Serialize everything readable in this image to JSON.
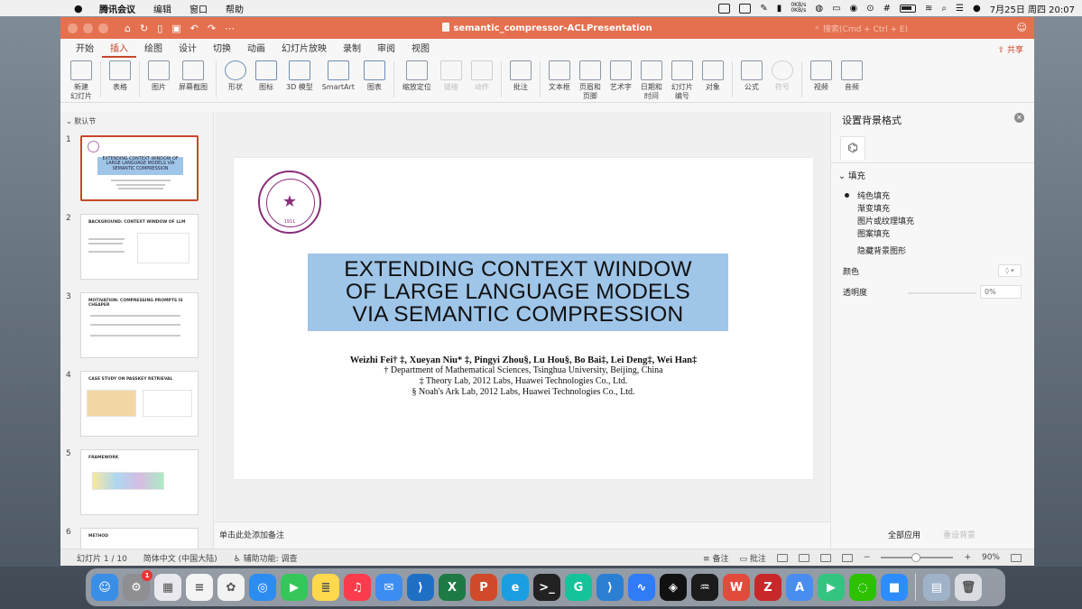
{
  "menubar": {
    "app_name": "腾讯会议",
    "items": [
      "编辑",
      "窗口",
      "帮助"
    ],
    "net_up": "0KB/s",
    "net_down": "0KB/s",
    "datetime": "7月25日 周四  20:07"
  },
  "window": {
    "title": "semantic_compressor-ACLPresentation",
    "search_placeholder": "搜索(Cmd + Ctrl + E)",
    "accent_color": "#e5704f"
  },
  "menu_tabs": [
    "开始",
    "插入",
    "绘图",
    "设计",
    "切换",
    "动画",
    "幻灯片放映",
    "录制",
    "审阅",
    "视图"
  ],
  "active_tab": "插入",
  "share_label": "共享",
  "ribbon": [
    {
      "label": "新建\n幻灯片",
      "icon": "new-slide-icon",
      "disabled": false
    },
    {
      "label": "表格",
      "icon": "table-icon",
      "disabled": false
    },
    {
      "label": "图片",
      "icon": "picture-icon",
      "disabled": false
    },
    {
      "label": "屏幕截图",
      "icon": "screenshot-icon",
      "disabled": false
    },
    {
      "label": "形状",
      "icon": "shape-icon",
      "disabled": false
    },
    {
      "label": "图标",
      "icon": "icons-icon",
      "disabled": false
    },
    {
      "label": "3D 模型",
      "icon": "3d-model-icon",
      "disabled": false
    },
    {
      "label": "SmartArt",
      "icon": "smartart-icon",
      "disabled": false
    },
    {
      "label": "图表",
      "icon": "chart-icon",
      "disabled": false
    },
    {
      "label": "缩放定位",
      "icon": "zoom-icon",
      "disabled": false
    },
    {
      "label": "链接",
      "icon": "link-icon",
      "disabled": true
    },
    {
      "label": "动作",
      "icon": "action-icon",
      "disabled": true
    },
    {
      "label": "批注",
      "icon": "comment-icon",
      "disabled": false
    },
    {
      "label": "文本框",
      "icon": "textbox-icon",
      "disabled": false
    },
    {
      "label": "页眉和\n页脚",
      "icon": "header-footer-icon",
      "disabled": false
    },
    {
      "label": "艺术字",
      "icon": "wordart-icon",
      "disabled": false
    },
    {
      "label": "日期和\n时间",
      "icon": "date-time-icon",
      "disabled": false
    },
    {
      "label": "幻灯片\n编号",
      "icon": "slide-number-icon",
      "disabled": false
    },
    {
      "label": "对象",
      "icon": "object-icon",
      "disabled": false
    },
    {
      "label": "公式",
      "icon": "equation-icon",
      "disabled": false
    },
    {
      "label": "符号",
      "icon": "symbol-icon",
      "disabled": true
    },
    {
      "label": "视频",
      "icon": "video-icon",
      "disabled": false
    },
    {
      "label": "音频",
      "icon": "audio-icon",
      "disabled": false
    }
  ],
  "slides_pane": {
    "section": "默认节",
    "slides": [
      {
        "num": "1",
        "title": "EXTENDING CONTEXT WINDOW OF LARGE LANGUAGE MODELS VIA SEMANTIC COMPRESSION"
      },
      {
        "num": "2",
        "title": "BACKGROUND: CONTEXT WINDOW OF LLM"
      },
      {
        "num": "3",
        "title": "MOTIVATION: COMPRESSING PROMPTS IS CHEAPER"
      },
      {
        "num": "4",
        "title": "CASE STUDY ON PASSKEY RETRIEVAL"
      },
      {
        "num": "5",
        "title": "FRAMEWORK"
      },
      {
        "num": "6",
        "title": "METHOD"
      }
    ]
  },
  "slide": {
    "seal_year": "1911",
    "title_lines": [
      "EXTENDING CONTEXT WINDOW",
      "OF LARGE LANGUAGE MODELS",
      "VIA SEMANTIC COMPRESSION"
    ],
    "authors": "Weizhi Fei† ‡, Xueyan Niu* ‡, Pingyi Zhou§, Lu Hou§, Bo Bai‡, Lei Deng‡, Wei Han‡",
    "affiliations": [
      "† Department of Mathematical Sciences, Tsinghua University, Beijing, China",
      "‡ Theory Lab, 2012 Labs, Huawei Technologies Co., Ltd.",
      "§ Noah's Ark Lab, 2012 Labs, Huawei Technologies Co., Ltd."
    ],
    "title_bg": "#9fc5e8"
  },
  "notes_placeholder": "单击此处添加备注",
  "format_panel": {
    "title": "设置背景格式",
    "section": "填充",
    "options": [
      "纯色填充",
      "渐变填充",
      "图片或纹理填充",
      "图案填充"
    ],
    "hide_bg": "隐藏背景图形",
    "color_label": "颜色",
    "transparency_label": "透明度",
    "transparency_value": "0%",
    "apply_all": "全部应用",
    "reset_bg": "重设背景"
  },
  "statusbar": {
    "slide_info": "幻灯片 1 / 10",
    "language": "简体中文 (中国大陆)",
    "accessibility": "辅助功能: 调查",
    "notes": "备注",
    "comments": "批注",
    "zoom": "90%"
  },
  "dock": {
    "apps": [
      {
        "name": "finder-icon",
        "color": "#3a8ee6",
        "glyph": "☺"
      },
      {
        "name": "system-settings-icon",
        "color": "#8e8e93",
        "glyph": "⚙",
        "badge": "1"
      },
      {
        "name": "launchpad-icon",
        "color": "#e8e8ee",
        "glyph": "▦"
      },
      {
        "name": "reminders-icon",
        "color": "#f4f4f4",
        "glyph": "≡"
      },
      {
        "name": "photos-icon",
        "color": "#f2f2f2",
        "glyph": "✿"
      },
      {
        "name": "safari-icon",
        "color": "#2d8cf0",
        "glyph": "◎"
      },
      {
        "name": "facetime-icon",
        "color": "#35c759",
        "glyph": "▶"
      },
      {
        "name": "notes-icon",
        "color": "#ffd84d",
        "glyph": "≣"
      },
      {
        "name": "music-icon",
        "color": "#fa3c4c",
        "glyph": "♫"
      },
      {
        "name": "mail-icon",
        "color": "#3b8df2",
        "glyph": "✉"
      },
      {
        "name": "vscode-icon",
        "color": "#1f6fc5",
        "glyph": "⟩"
      },
      {
        "name": "excel-icon",
        "color": "#1d7a45",
        "glyph": "X"
      },
      {
        "name": "powerpoint-icon",
        "color": "#d04a2a",
        "glyph": "P"
      },
      {
        "name": "edge-icon",
        "color": "#1b9de2",
        "glyph": "e"
      },
      {
        "name": "terminal-icon",
        "color": "#222222",
        "glyph": ">_"
      },
      {
        "name": "grammarly-icon",
        "color": "#15c39a",
        "glyph": "G"
      },
      {
        "name": "vscode-alt-icon",
        "color": "#2b7fd3",
        "glyph": "⟩"
      },
      {
        "name": "tencent-meeting-icon",
        "color": "#2f7cf6",
        "glyph": "∿"
      },
      {
        "name": "chatgpt-icon",
        "color": "#111111",
        "glyph": "◈"
      },
      {
        "name": "activity-monitor-icon",
        "color": "#1b1b1b",
        "glyph": "♒"
      },
      {
        "name": "wps-icon",
        "color": "#e24a3b",
        "glyph": "W"
      },
      {
        "name": "zotero-icon",
        "color": "#c8282a",
        "glyph": "Z"
      },
      {
        "name": "translate-icon",
        "color": "#4a8df0",
        "glyph": "A"
      },
      {
        "name": "infuse-icon",
        "color": "#33c481",
        "glyph": "▶"
      },
      {
        "name": "wechat-icon",
        "color": "#2dc100",
        "glyph": "◌"
      },
      {
        "name": "zoom-icon",
        "color": "#2d8cff",
        "glyph": "■"
      },
      {
        "name": "downloads-icon",
        "color": "#9fb3c8",
        "glyph": "▤"
      },
      {
        "name": "trash-icon",
        "color": "#d9dde2",
        "glyph": "🗑"
      }
    ]
  }
}
